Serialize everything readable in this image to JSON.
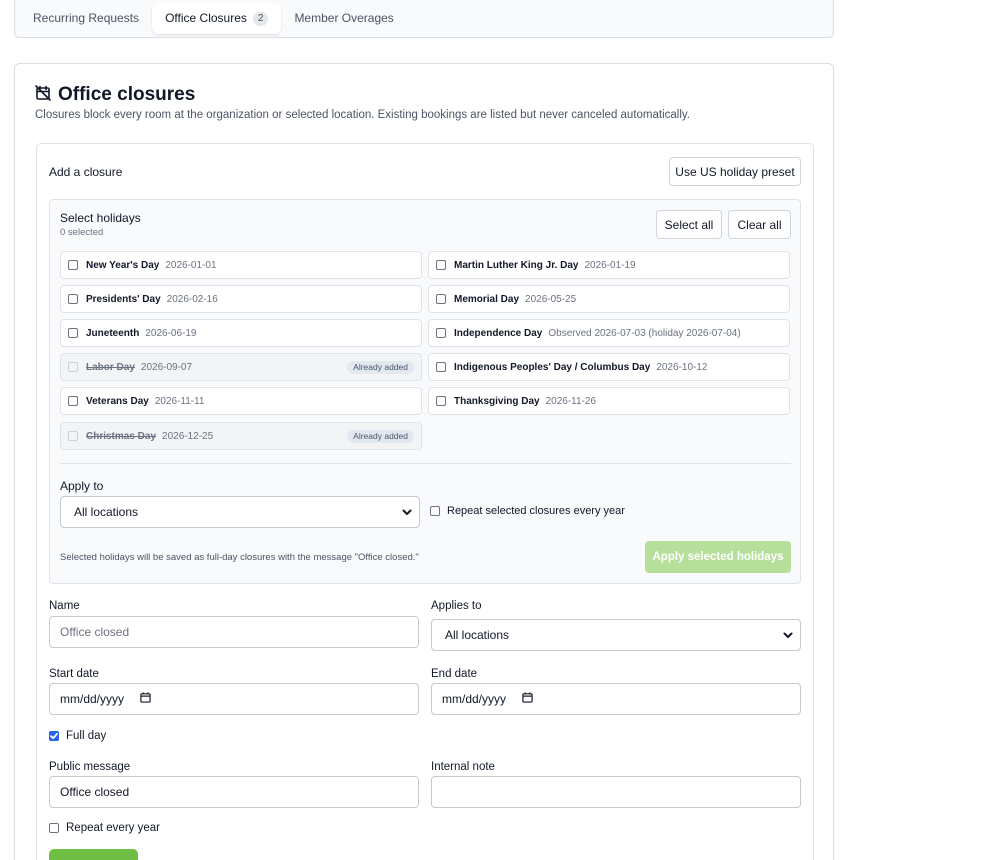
{
  "tabs": [
    {
      "label": "Recurring Requests",
      "active": false
    },
    {
      "label": "Office Closures",
      "active": true,
      "badge": "2"
    },
    {
      "label": "Member Overages",
      "active": false
    }
  ],
  "card": {
    "icon": "calendar-off-icon",
    "title": "Office closures",
    "description": "Closures block every room at the organization or selected location. Existing bookings are listed but never canceled automatically."
  },
  "add": {
    "title": "Add a closure",
    "preset_button": "Use US holiday preset"
  },
  "holidays": {
    "title": "Select holidays",
    "count": "0 selected",
    "select_all": "Select all",
    "clear_all": "Clear all",
    "already_added_label": "Already added",
    "items": [
      {
        "name": "New Year's Day",
        "date": "2026-01-01",
        "disabled": false
      },
      {
        "name": "Martin Luther King Jr. Day",
        "date": "2026-01-19",
        "disabled": false
      },
      {
        "name": "Presidents' Day",
        "date": "2026-02-16",
        "disabled": false
      },
      {
        "name": "Memorial Day",
        "date": "2026-05-25",
        "disabled": false
      },
      {
        "name": "Juneteenth",
        "date": "2026-06-19",
        "disabled": false
      },
      {
        "name": "Independence Day",
        "date": "Observed 2026-07-03 (holiday 2026-07-04)",
        "disabled": false
      },
      {
        "name": "Labor Day",
        "date": "2026-09-07",
        "disabled": true
      },
      {
        "name": "Indigenous Peoples' Day / Columbus Day",
        "date": "2026-10-12",
        "disabled": false
      },
      {
        "name": "Veterans Day",
        "date": "2026-11-11",
        "disabled": false
      },
      {
        "name": "Thanksgiving Day",
        "date": "2026-11-26",
        "disabled": false
      },
      {
        "name": "Christmas Day",
        "date": "2026-12-25",
        "disabled": true
      }
    ],
    "apply_to_label": "Apply to",
    "apply_to_value": "All locations",
    "repeat_label": "Repeat selected closures every year",
    "note": "Selected holidays will be saved as full-day closures with the message \"Office closed.\"",
    "apply_button": "Apply selected holidays"
  },
  "form": {
    "name_label": "Name",
    "name_placeholder": "Office closed",
    "applies_to_label": "Applies to",
    "applies_to_value": "All locations",
    "start_label": "Start date",
    "start_value": "mm/dd/yyyy",
    "end_label": "End date",
    "end_value": "mm/dd/yyyy",
    "full_day_label": "Full day",
    "full_day_checked": true,
    "public_message_label": "Public message",
    "public_message_value": "Office closed",
    "internal_note_label": "Internal note",
    "internal_note_value": "",
    "repeat_label": "Repeat every year"
  },
  "colors": {
    "primary_green": "#6fbe44",
    "disabled_green": "#b6df9c",
    "checkbox_blue": "#2563eb"
  }
}
